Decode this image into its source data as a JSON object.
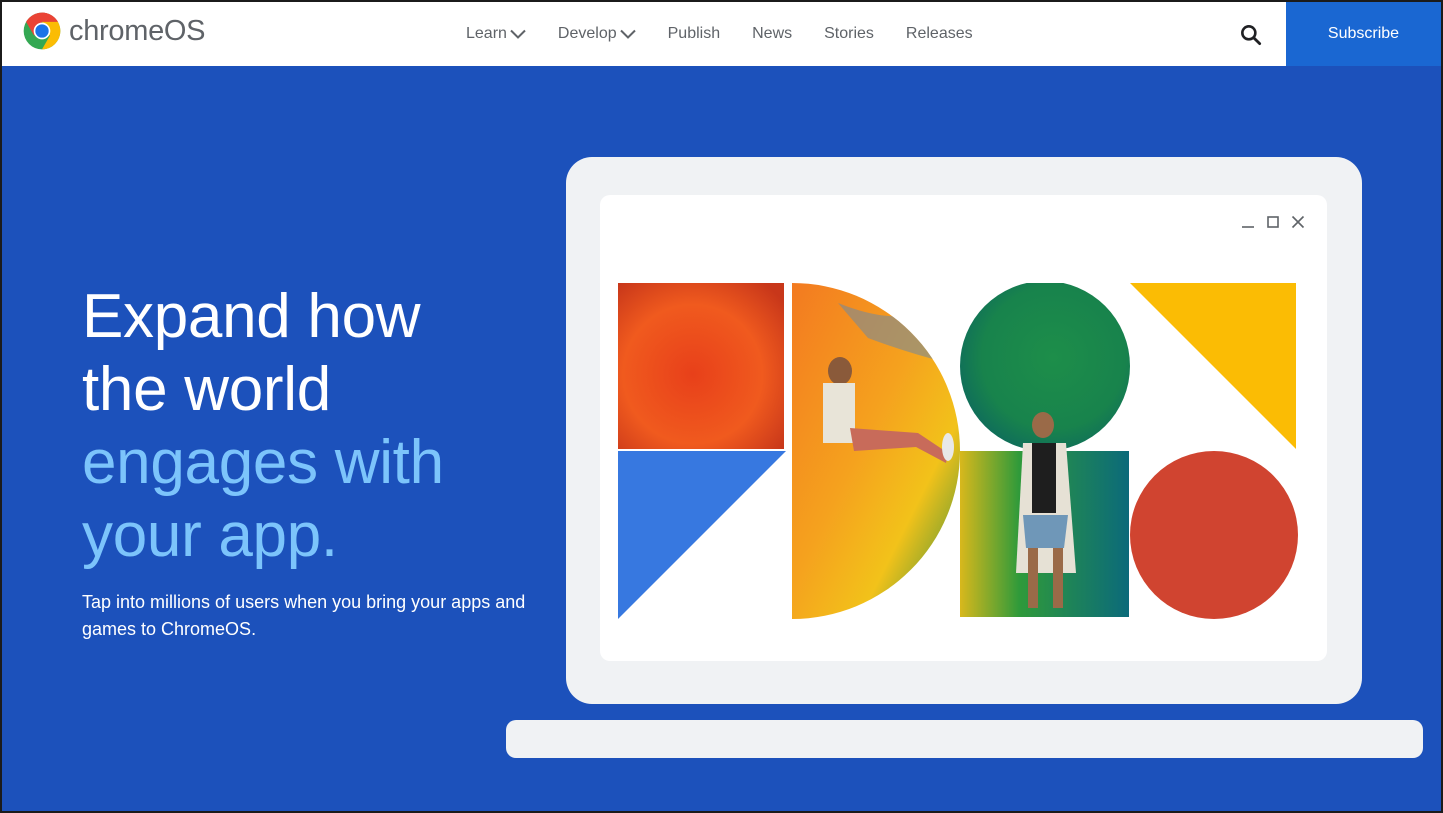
{
  "header": {
    "logo_text": "chromeOS",
    "logo_icon": "chrome-logo-icon",
    "nav": [
      {
        "label": "Learn",
        "has_dropdown": true
      },
      {
        "label": "Develop",
        "has_dropdown": true
      },
      {
        "label": "Publish",
        "has_dropdown": false
      },
      {
        "label": "News",
        "has_dropdown": false
      },
      {
        "label": "Stories",
        "has_dropdown": false
      },
      {
        "label": "Releases",
        "has_dropdown": false
      }
    ],
    "search_icon": "search-icon",
    "subscribe_label": "Subscribe"
  },
  "hero": {
    "title_line1": "Expand how",
    "title_line2": "the world",
    "title_line3": "engages with",
    "title_line4": "your app.",
    "subtitle": "Tap into millions of users when you bring your apps and games to ChromeOS."
  },
  "illustration": {
    "window_controls": [
      "minimize-icon",
      "maximize-icon",
      "close-icon"
    ],
    "colors": {
      "background": "#1c51bb",
      "accent_text": "#7cc4fb",
      "subscribe": "#1a67d2",
      "blue": "#3778e0",
      "yellow": "#fbbc04",
      "red": "#d04430",
      "green": "#1a8a4a",
      "orange": "#f07820",
      "laptop": "#f0f2f4"
    }
  }
}
